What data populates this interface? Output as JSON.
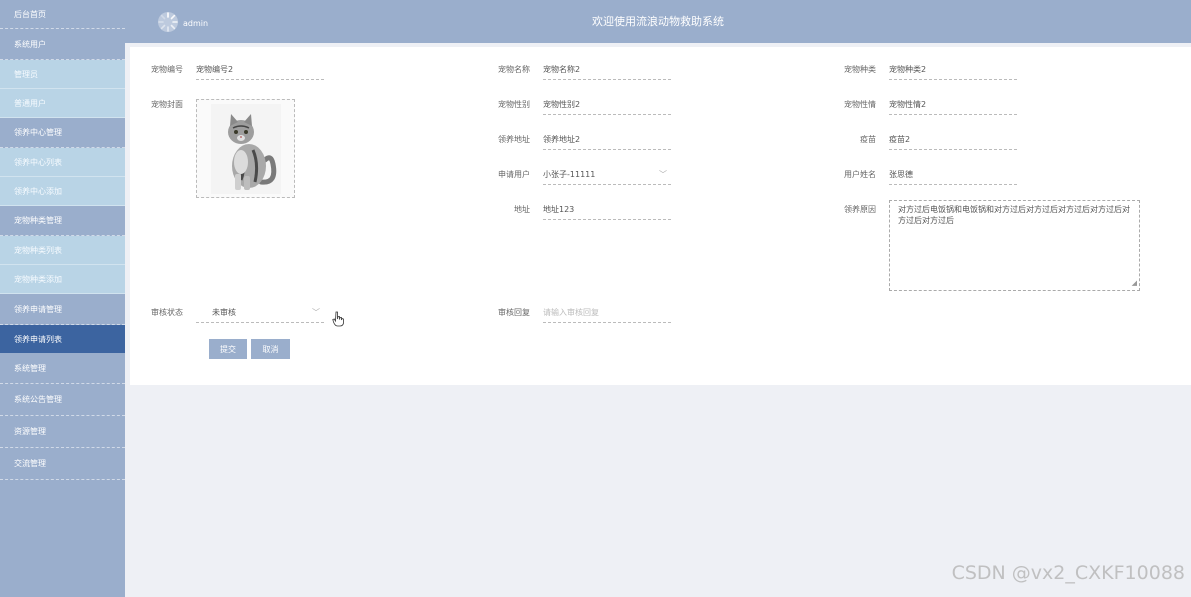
{
  "sidebar": {
    "items": [
      {
        "label": "后台首页",
        "type": "group"
      },
      {
        "label": "系统用户",
        "type": "group"
      },
      {
        "label": "管理员",
        "type": "sub"
      },
      {
        "label": "普通用户",
        "type": "sub"
      },
      {
        "label": "领养中心管理",
        "type": "group"
      },
      {
        "label": "领养中心列表",
        "type": "sub"
      },
      {
        "label": "领养中心添加",
        "type": "sub"
      },
      {
        "label": "宠物种类管理",
        "type": "group"
      },
      {
        "label": "宠物种类列表",
        "type": "sub"
      },
      {
        "label": "宠物种类添加",
        "type": "sub"
      },
      {
        "label": "领养申请管理",
        "type": "group"
      },
      {
        "label": "领养申请列表",
        "type": "active"
      },
      {
        "label": "系统管理",
        "type": "group"
      },
      {
        "label": "系统公告管理",
        "type": "group"
      },
      {
        "label": "资源管理",
        "type": "group"
      },
      {
        "label": "交流管理",
        "type": "group"
      }
    ]
  },
  "header": {
    "admin_name": "admin",
    "title": "欢迎使用流浪动物救助系统"
  },
  "form": {
    "pet_no": {
      "label": "宠物编号",
      "value": "宠物编号2"
    },
    "pet_name": {
      "label": "宠物名称",
      "value": "宠物名称2"
    },
    "pet_type": {
      "label": "宠物种类",
      "value": "宠物种类2"
    },
    "pet_cover": {
      "label": "宠物封面"
    },
    "pet_gender": {
      "label": "宠物性别",
      "value": "宠物性别2"
    },
    "pet_personality": {
      "label": "宠物性情",
      "value": "宠物性情2"
    },
    "adopt_address": {
      "label": "领养地址",
      "value": "领养地址2"
    },
    "vaccine": {
      "label": "疫苗",
      "value": "疫苗2"
    },
    "applicant": {
      "label": "申请用户",
      "value": "小张子-11111"
    },
    "user_name": {
      "label": "用户姓名",
      "value": "张思德"
    },
    "address": {
      "label": "地址",
      "value": "地址123"
    },
    "adopt_reason": {
      "label": "领养原因",
      "value": "对方过后电饭锅和电饭锅和对方过后对方过后对方过后对方过后对方过后对方过后"
    },
    "review_status": {
      "label": "审核状态",
      "value": "未审核"
    },
    "review_reply": {
      "label": "审核回复",
      "placeholder": "请输入审核回复"
    },
    "submit_label": "提交",
    "cancel_label": "取消"
  },
  "watermark": "CSDN @vx2_CXKF10088",
  "colors": {
    "sidebar": "#9aaecc",
    "active": "#3c64a0",
    "sub": "#b9d4e6"
  }
}
